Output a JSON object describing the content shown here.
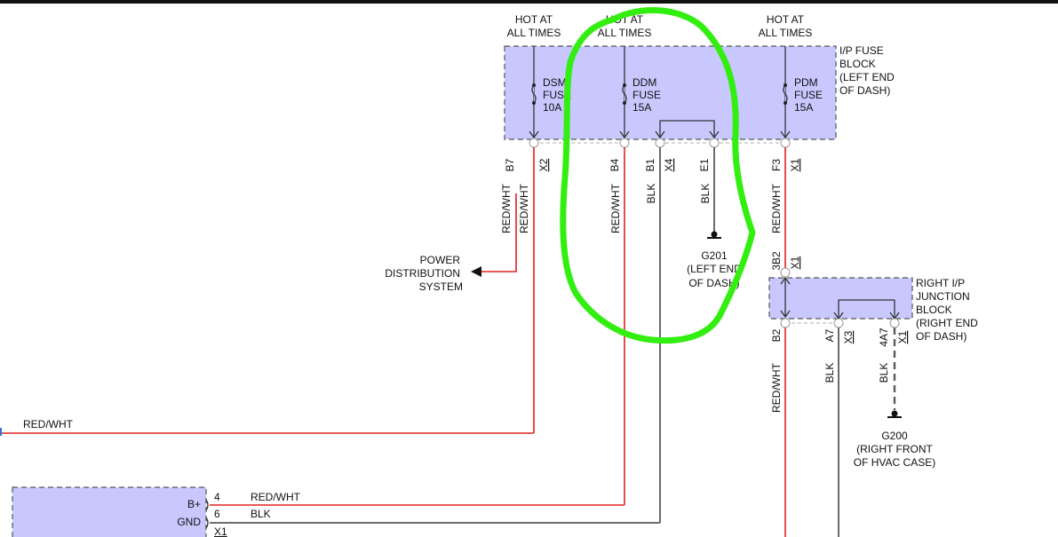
{
  "fuse_block": {
    "label": [
      "I/P FUSE",
      "BLOCK",
      "(LEFT END",
      "OF DASH)"
    ],
    "hot": [
      "HOT AT",
      "ALL TIMES"
    ],
    "fuses": [
      {
        "name": "DSM",
        "type": "FUSE",
        "rating": "10A",
        "pin": "B7",
        "connector": "X2",
        "wire": "RED/WHT"
      },
      {
        "name": "DDM",
        "type": "FUSE",
        "rating": "15A",
        "pin": "B4",
        "connector": "",
        "wire": "RED/WHT"
      },
      {
        "name": "PDM",
        "type": "FUSE",
        "rating": "15A",
        "pin": "F3",
        "connector": "X1",
        "wire": "RED/WHT"
      }
    ],
    "extra_pins": [
      {
        "pin": "B1",
        "connector": "X4",
        "wire": "BLK"
      },
      {
        "pin": "E1",
        "connector": "",
        "wire": "BLK"
      }
    ]
  },
  "ground_g201": {
    "name": "G201",
    "location": [
      "(LEFT END",
      "OF DASH)"
    ]
  },
  "power_distribution": [
    "POWER",
    "DISTRIBUTION",
    "SYSTEM"
  ],
  "left_wire_label": "RED/WHT",
  "left_wire_label_2": "RED/WHT",
  "junction_block": {
    "label": [
      "RIGHT I/P",
      "JUNCTION",
      "BLOCK",
      "(RIGHT END",
      "OF DASH)"
    ],
    "top_pin": "3B2",
    "top_connector": "X1",
    "pins": [
      {
        "pin": "B2",
        "connector": "",
        "wire": "RED/WHT"
      },
      {
        "pin": "A7",
        "connector": "X3",
        "wire": "BLK"
      },
      {
        "pin": "4A7",
        "connector": "X1",
        "wire": "BLK"
      }
    ]
  },
  "ground_g200": {
    "name": "G200",
    "location": [
      "(RIGHT FRONT",
      "OF HVAC CASE)"
    ]
  },
  "bottom_wire_label": "RED/WHT",
  "module": {
    "pins": [
      {
        "label": "B+",
        "number": "4",
        "wire": "RED/WHT"
      },
      {
        "label": "GND",
        "number": "6",
        "wire": "BLK"
      }
    ],
    "connector": "X1"
  },
  "annotation": {
    "type": "freehand-circle",
    "color": "#33ee11"
  }
}
